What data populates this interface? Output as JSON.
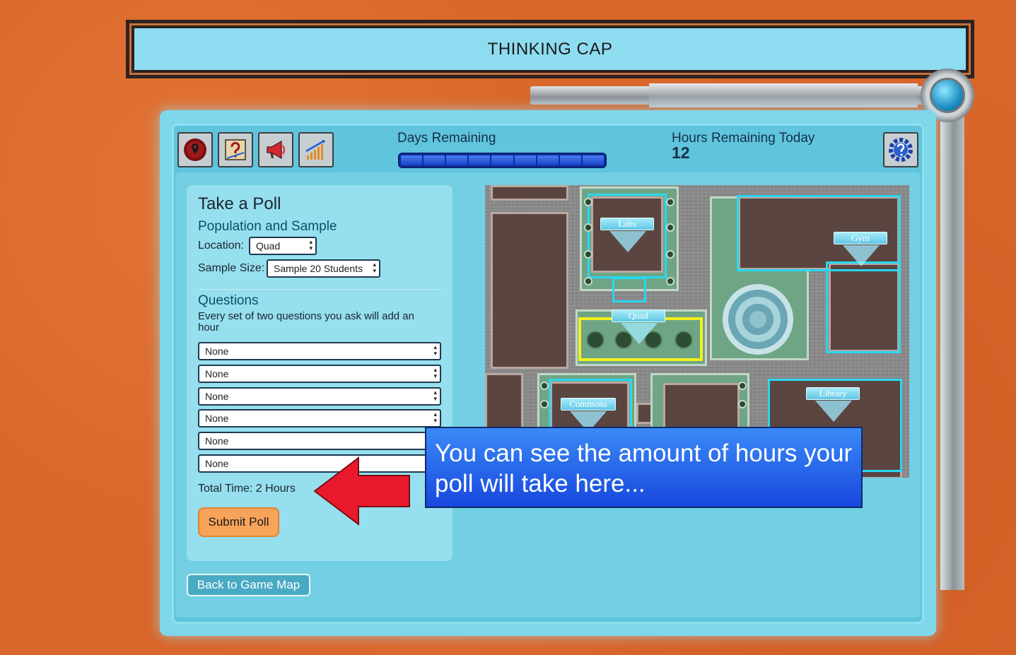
{
  "header": {
    "title": "THINKING CAP"
  },
  "toolbar": {
    "buttons": [
      {
        "name": "map-pin-icon"
      },
      {
        "name": "quiz-icon"
      },
      {
        "name": "megaphone-icon"
      },
      {
        "name": "chart-icon"
      }
    ],
    "settings_icon": "help-gear-icon"
  },
  "status": {
    "days_label": "Days Remaining",
    "days_total": 9,
    "days_remaining": 9,
    "hours_label": "Hours Remaining Today",
    "hours_value": "12"
  },
  "poll": {
    "title": "Take a Poll",
    "population_heading": "Population and Sample",
    "location_label": "Location:",
    "location_value": "Quad",
    "sample_label": "Sample Size:",
    "sample_value": "Sample 20 Students",
    "questions_heading": "Questions",
    "questions_note": "Every set of two questions you ask will add an hour",
    "questions": [
      "None",
      "None",
      "None",
      "None",
      "None",
      "None"
    ],
    "total_time": "Total Time: 2 Hours",
    "submit_label": "Submit Poll"
  },
  "back_button": "Back to Game Map",
  "map": {
    "labels": [
      "Labs",
      "Gym",
      "Quad",
      "Commons",
      "Library"
    ],
    "selected": "Quad"
  },
  "tutorial": {
    "text": "You can see the amount of hours your poll will take here..."
  },
  "colors": {
    "background": "#d9662a",
    "panel": "#7fd7ea",
    "highlight_cyan": "#28d8f0",
    "highlight_selected": "#f4ef1c",
    "arrow": "#e8192c",
    "callout": "#1f5be6"
  }
}
